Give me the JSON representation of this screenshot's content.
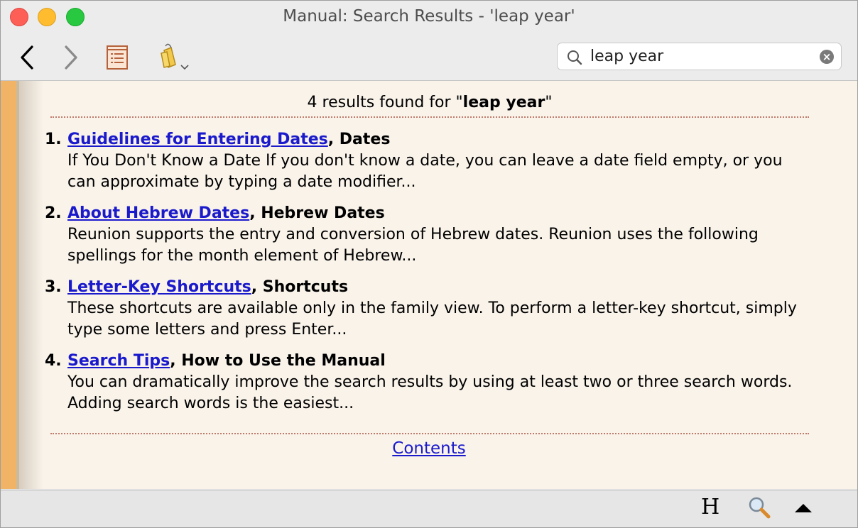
{
  "window": {
    "title": "Manual: Search Results - 'leap year'"
  },
  "toolbar": {
    "back_icon": "chevron-left-icon",
    "forward_icon": "chevron-right-icon",
    "toc_icon": "list-page-icon",
    "bookmark_icon": "bookmark-tag-icon",
    "search": {
      "value": "leap year",
      "placeholder": ""
    }
  },
  "results": {
    "summary_prefix": "4 results found for \"",
    "query": "leap year",
    "summary_suffix": "\"",
    "items": [
      {
        "num": "1.",
        "link": "Guidelines for Entering Dates",
        "section": ", Dates",
        "snippet": "If You Don't Know a Date If you don't know a date, you can leave a date field empty, or you can approximate by typing a date modifier..."
      },
      {
        "num": "2.",
        "link": "About Hebrew Dates",
        "section": ", Hebrew Dates",
        "snippet": "Reunion supports the entry and conversion of Hebrew dates. Reunion uses the following spellings for the month element of Hebrew..."
      },
      {
        "num": "3.",
        "link": "Letter-Key Shortcuts",
        "section": ", Shortcuts",
        "snippet": "These shortcuts are available only in the family view. To perform a letter-key shortcut, simply type some letters and press Enter..."
      },
      {
        "num": "4.",
        "link": "Search Tips",
        "section": ", How to Use the Manual",
        "snippet": "You can dramatically improve the search results by using at least two or three search words. Adding search words is the easiest..."
      }
    ],
    "contents_link": "Contents"
  },
  "statusbar": {
    "h_label": "H"
  },
  "colors": {
    "link": "#1a1acc",
    "background": "#f9f3ea",
    "stripe": "#f1b466"
  }
}
